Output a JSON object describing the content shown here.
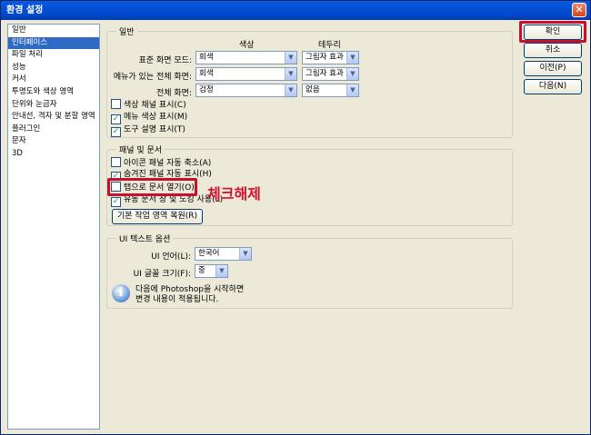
{
  "window": {
    "title": "환경 설정",
    "close_glyph": "✕"
  },
  "sidebar": {
    "items": [
      {
        "label": "일반"
      },
      {
        "label": "인터페이스"
      },
      {
        "label": "파일 처리"
      },
      {
        "label": "성능"
      },
      {
        "label": "커서"
      },
      {
        "label": "투명도와 색상 영역"
      },
      {
        "label": "단위와 눈금자"
      },
      {
        "label": "안내선, 격자 및 분할 영역"
      },
      {
        "label": "플러그인"
      },
      {
        "label": "문자"
      },
      {
        "label": "3D"
      }
    ],
    "selected": "인터페이스"
  },
  "general": {
    "legend": "일반",
    "col_color": "색상",
    "col_border": "테두리",
    "rows": [
      {
        "label": "표준 화면 모드:",
        "color": "회색",
        "border": "그림자 효과"
      },
      {
        "label": "메뉴가 있는 전체 화면:",
        "color": "회색",
        "border": "그림자 효과"
      },
      {
        "label": "전체 화면:",
        "color": "검정",
        "border": "없음"
      }
    ],
    "checkboxes": [
      {
        "label": "색상 채널 표시(C)",
        "checked": false
      },
      {
        "label": "메뉴 색상 표시(M)",
        "checked": true
      },
      {
        "label": "도구 설명 표시(T)",
        "checked": true
      }
    ]
  },
  "panels": {
    "legend": "패널 및 문서",
    "checkboxes": [
      {
        "label": "아이콘 패널 자동 축소(A)",
        "checked": false
      },
      {
        "label": "숨겨진 패널 자동 표시(H)",
        "checked": true
      },
      {
        "label": "탭으로 문서 열기(O)",
        "checked": false
      },
      {
        "label": "유동 문서 창 및 도킹 사용(L)",
        "checked": true
      }
    ],
    "restore_button": "기본 작업 영역 복원(R)"
  },
  "ui_text": {
    "legend": "UI 텍스트 옵션",
    "language_label": "UI 언어(L):",
    "language_value": "한국어",
    "font_size_label": "UI 글꼴 크기(F):",
    "font_size_value": "중",
    "info_line1": "다음에 Photoshop을 시작하면",
    "info_line2": "변경 내용이 적용됩니다."
  },
  "buttons": {
    "ok": "확인",
    "cancel": "취소",
    "prev": "이전(P)",
    "next": "다음(N)"
  },
  "annotation": {
    "text": "체크해제",
    "color": "#d0102c"
  }
}
